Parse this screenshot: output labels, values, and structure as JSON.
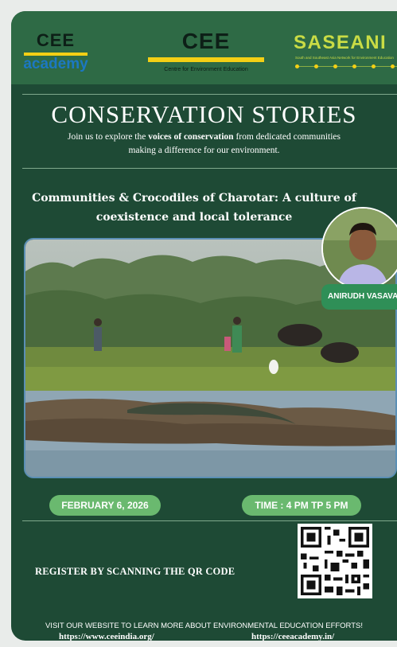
{
  "logos": {
    "academy_top": "CEE",
    "academy_bottom": "academy",
    "cee_big": "CEE",
    "cee_small": "Centre for Environment Education",
    "saseane_big": "SASEANI",
    "saseane_sub": "South and Southeast Asia Network for Environment Education"
  },
  "title": "CONSERVATION STORIES",
  "intro": {
    "prefix": "Join us to explore the ",
    "bold": "voices of conservation",
    "suffix": " from dedicated communities making a difference for our environment."
  },
  "talk_title": "Communities & Crocodiles of Charotar: A culture of coexistence and local tolerance",
  "speaker": {
    "name": "ANIRUDH VASAVA"
  },
  "date": "FEBRUARY 6, 2026",
  "time": "TIME : 4 PM TP 5 PM",
  "register": "REGISTER BY SCANNING THE QR CODE",
  "footer": {
    "visit": "VISIT OUR WEBSITE TO LEARN MORE ABOUT ENVIRONMENTAL EDUCATION EFFORTS!",
    "url1": "https://www.ceeindia.org/",
    "url2": "https://ceeacademy.in/"
  },
  "colors": {
    "poster_bg": "#1e4a35",
    "header_bg": "#2e6a45",
    "accent_yellow": "#f3cf15",
    "pill_green": "#6ab96f",
    "academy_blue": "#1c78c2"
  },
  "icons": {
    "qr": "qr-code",
    "speaker_photo": "speaker-portrait",
    "event_photo": "crocodile-wetland-photo"
  }
}
